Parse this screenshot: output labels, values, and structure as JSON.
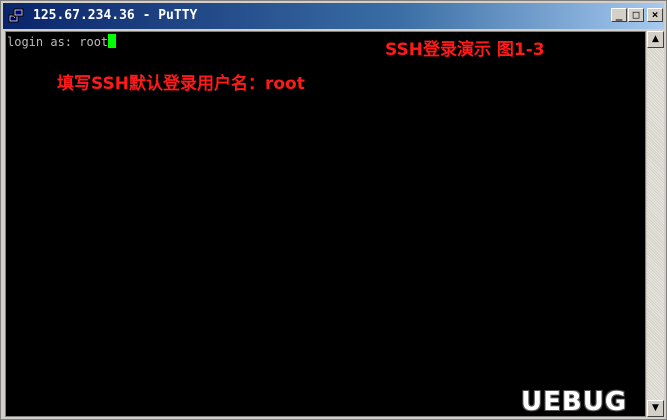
{
  "window": {
    "title": "125.67.234.36 - PuTTY",
    "icon": "putty-icon",
    "buttons": {
      "minimize": "_",
      "maximize": "□",
      "close": "×"
    }
  },
  "terminal": {
    "prompt_line": "login as: root",
    "cursor_color": "#00ff00",
    "background": "#000000"
  },
  "annotations": {
    "caption": "SSH登录演示 图1-3",
    "instruction": "填写SSH默认登录用户名：root",
    "color": "#ff1a1a"
  },
  "scrollbar": {
    "up": "▲",
    "down": "▼"
  },
  "watermark": {
    "text": "UEBUG"
  }
}
